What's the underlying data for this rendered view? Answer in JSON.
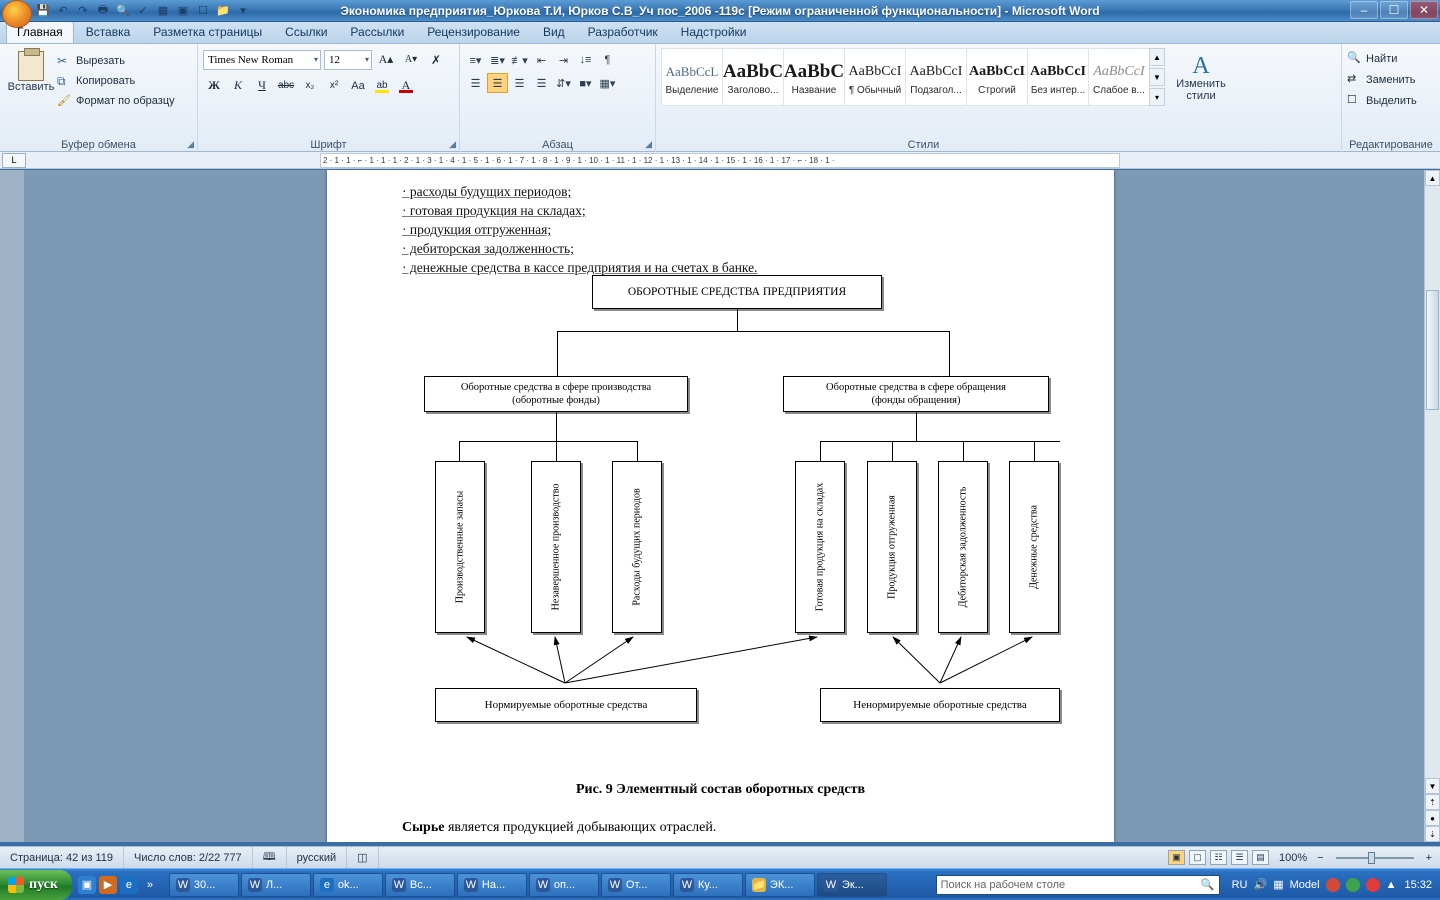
{
  "titlebar": {
    "title": "Экономика предприятия_Юркова Т.И, Юрков С.В_Уч пос_2006 -119с [Режим ограниченной функциональности] - Microsoft Word",
    "qat": [
      {
        "name": "save-icon",
        "glyph": "💾"
      },
      {
        "name": "undo-icon",
        "glyph": "↶"
      },
      {
        "name": "redo-icon",
        "glyph": "↷"
      },
      {
        "name": "print-icon",
        "glyph": "🖨"
      },
      {
        "name": "print-preview-icon",
        "glyph": "🔍"
      },
      {
        "name": "spelling-icon",
        "glyph": "A✓"
      },
      {
        "name": "table-icon",
        "glyph": "▦"
      },
      {
        "name": "picture-icon",
        "glyph": "🏞"
      },
      {
        "name": "new-icon",
        "glyph": "❐"
      },
      {
        "name": "open-icon",
        "glyph": "📂"
      },
      {
        "name": "customize-icon",
        "glyph": "▾"
      }
    ],
    "window_buttons": [
      {
        "name": "minimize-button",
        "glyph": "–"
      },
      {
        "name": "restore-button",
        "glyph": "❐"
      },
      {
        "name": "close-button",
        "glyph": "✕"
      }
    ]
  },
  "tabs": [
    {
      "label": "Главная",
      "active": true
    },
    {
      "label": "Вставка",
      "active": false
    },
    {
      "label": "Разметка страницы",
      "active": false
    },
    {
      "label": "Ссылки",
      "active": false
    },
    {
      "label": "Рассылки",
      "active": false
    },
    {
      "label": "Рецензирование",
      "active": false
    },
    {
      "label": "Вид",
      "active": false
    },
    {
      "label": "Разработчик",
      "active": false
    },
    {
      "label": "Надстройки",
      "active": false
    }
  ],
  "ribbon": {
    "clipboard": {
      "group_label": "Буфер обмена",
      "paste_label": "Вставить",
      "items": [
        {
          "label": "Вырезать",
          "icon": "cut-icon"
        },
        {
          "label": "Копировать",
          "icon": "copy-icon"
        },
        {
          "label": "Формат по образцу",
          "icon": "format-painter-icon"
        }
      ]
    },
    "font": {
      "group_label": "Шрифт",
      "family": "Times New Roman",
      "size": "12",
      "buttons": [
        {
          "label": "Ж",
          "name": "bold-button"
        },
        {
          "label": "К",
          "name": "italic-button"
        },
        {
          "label": "Ч",
          "name": "underline-button"
        },
        {
          "label": "abc",
          "name": "strikethrough-button"
        },
        {
          "label": "x₂",
          "name": "subscript-button"
        },
        {
          "label": "x²",
          "name": "superscript-button"
        },
        {
          "label": "Aa",
          "name": "change-case-button"
        },
        {
          "label": "A",
          "name": "grow-font-button"
        },
        {
          "label": "A",
          "name": "shrink-font-button"
        },
        {
          "label": "✇",
          "name": "clear-formatting-button"
        },
        {
          "label": "ab",
          "name": "text-highlight-button"
        },
        {
          "label": "A",
          "name": "font-color-button"
        }
      ]
    },
    "paragraph": {
      "group_label": "Абзац",
      "buttons": [
        "bullets-button",
        "numbering-button",
        "multilevel-list-button",
        "decrease-indent-button",
        "increase-indent-button",
        "sort-button",
        "show-marks-button",
        "align-left-button",
        "align-center-button",
        "align-right-button",
        "justify-button",
        "line-spacing-button",
        "shading-button",
        "borders-button"
      ]
    },
    "styles": {
      "group_label": "Стили",
      "items": [
        {
          "preview": "AaBbCcL",
          "name": "Выделение"
        },
        {
          "preview": "AaBbC",
          "name": "Заголово..."
        },
        {
          "preview": "AaBbC",
          "name": "Название"
        },
        {
          "preview": "AaBbCcI",
          "name": "Обычный",
          "prefix": "¶"
        },
        {
          "preview": "AaBbCcI",
          "name": "Подзагол..."
        },
        {
          "preview": "AaBbCcI",
          "name": "Строгий"
        },
        {
          "preview": "AaBbCcI",
          "name": "Без интер..."
        },
        {
          "preview": "AaBbCcI",
          "name": "Слабое в..."
        }
      ],
      "change_styles": "Изменить стили"
    },
    "editing": {
      "group_label": "Редактирование",
      "items": [
        {
          "label": "Найти",
          "icon": "find-icon"
        },
        {
          "label": "Заменить",
          "icon": "replace-icon"
        },
        {
          "label": "Выделить",
          "icon": "select-icon"
        }
      ]
    }
  },
  "ruler": {
    "corner": "L",
    "marks": "2 · 1 · 1 · ⌐ · 1 · 1 · 1 · 2 · 1 · 3 · 1 · 4 · 1 · 5 · 1 · 6 · 1 · 7 · 1 · 8 · 1 · 9 · 1 · 10 · 1 · 11 · 1 · 12 · 1 · 13 · 1 · 14 · 1 · 15 · 1 · 16 · 1 · 17 · ⌐ · 18 · 1 ·"
  },
  "document": {
    "list_items": [
      "· расходы будущих периодов;",
      "· готовая продукция на складах;",
      "· продукция отгруженная;",
      "· дебиторская задолженность;",
      "· денежные средства в кассе предприятия и на счетах в банке."
    ],
    "figure_caption": "Рис. 9 Элементный состав оборотных средств",
    "after_text_bold": "Сырье",
    "after_text_rest": " является продукцией добывающих отраслей."
  },
  "diagram": {
    "root": "ОБОРОТНЫЕ СРЕДСТВА ПРЕДПРИЯТИЯ",
    "branch_left": "Оборотные средства в сфере производства\n(оборотные фонды)",
    "branch_left_line1": "Оборотные средства в сфере производства",
    "branch_left_line2": "(оборотные фонды)",
    "branch_right_line1": "Оборотные средства в сфере обращения",
    "branch_right_line2": "(фонды обращения)",
    "vertical_items": [
      "Производственные запасы",
      "Незавершенное производство",
      "Расходы будущих периодов",
      "Готовая продукция на складах",
      "Продукция отгруженная",
      "Дебиторская задолженность",
      "Денежные средства"
    ],
    "bottom_left": "Нормируемые оборотные средства",
    "bottom_right": "Ненормируемые оборотные средства"
  },
  "statusbar": {
    "page": "Страница: 42 из 119",
    "words": "Число слов: 2/22 777",
    "language": "русский",
    "zoom": "100%",
    "views": [
      "print-layout-view",
      "full-screen-view",
      "web-layout-view",
      "outline-view",
      "draft-view"
    ]
  },
  "taskbar": {
    "start": "пуск",
    "quick_launch": [
      "show-desktop-icon",
      "media-player-icon",
      "internet-explorer-icon",
      "more-icon"
    ],
    "tasks": [
      {
        "label": "30...",
        "icon": "word-icon",
        "active": false
      },
      {
        "label": "Л...",
        "icon": "word-icon",
        "active": false
      },
      {
        "label": "ok...",
        "icon": "browser-icon",
        "active": false
      },
      {
        "label": "Вс...",
        "icon": "word-icon",
        "active": false
      },
      {
        "label": "На...",
        "icon": "word-icon",
        "active": false
      },
      {
        "label": "оп...",
        "icon": "word-icon",
        "active": false
      },
      {
        "label": "От...",
        "icon": "word-icon",
        "active": false
      },
      {
        "label": "Ку...",
        "icon": "word-icon",
        "active": false
      },
      {
        "label": "ЭК...",
        "icon": "folder-icon",
        "active": false
      },
      {
        "label": "Эк...",
        "icon": "word-icon",
        "active": true
      }
    ],
    "search_placeholder": "Поиск на рабочем столе",
    "lang": "RU",
    "tray_label": "Model",
    "clock": "15:32"
  }
}
